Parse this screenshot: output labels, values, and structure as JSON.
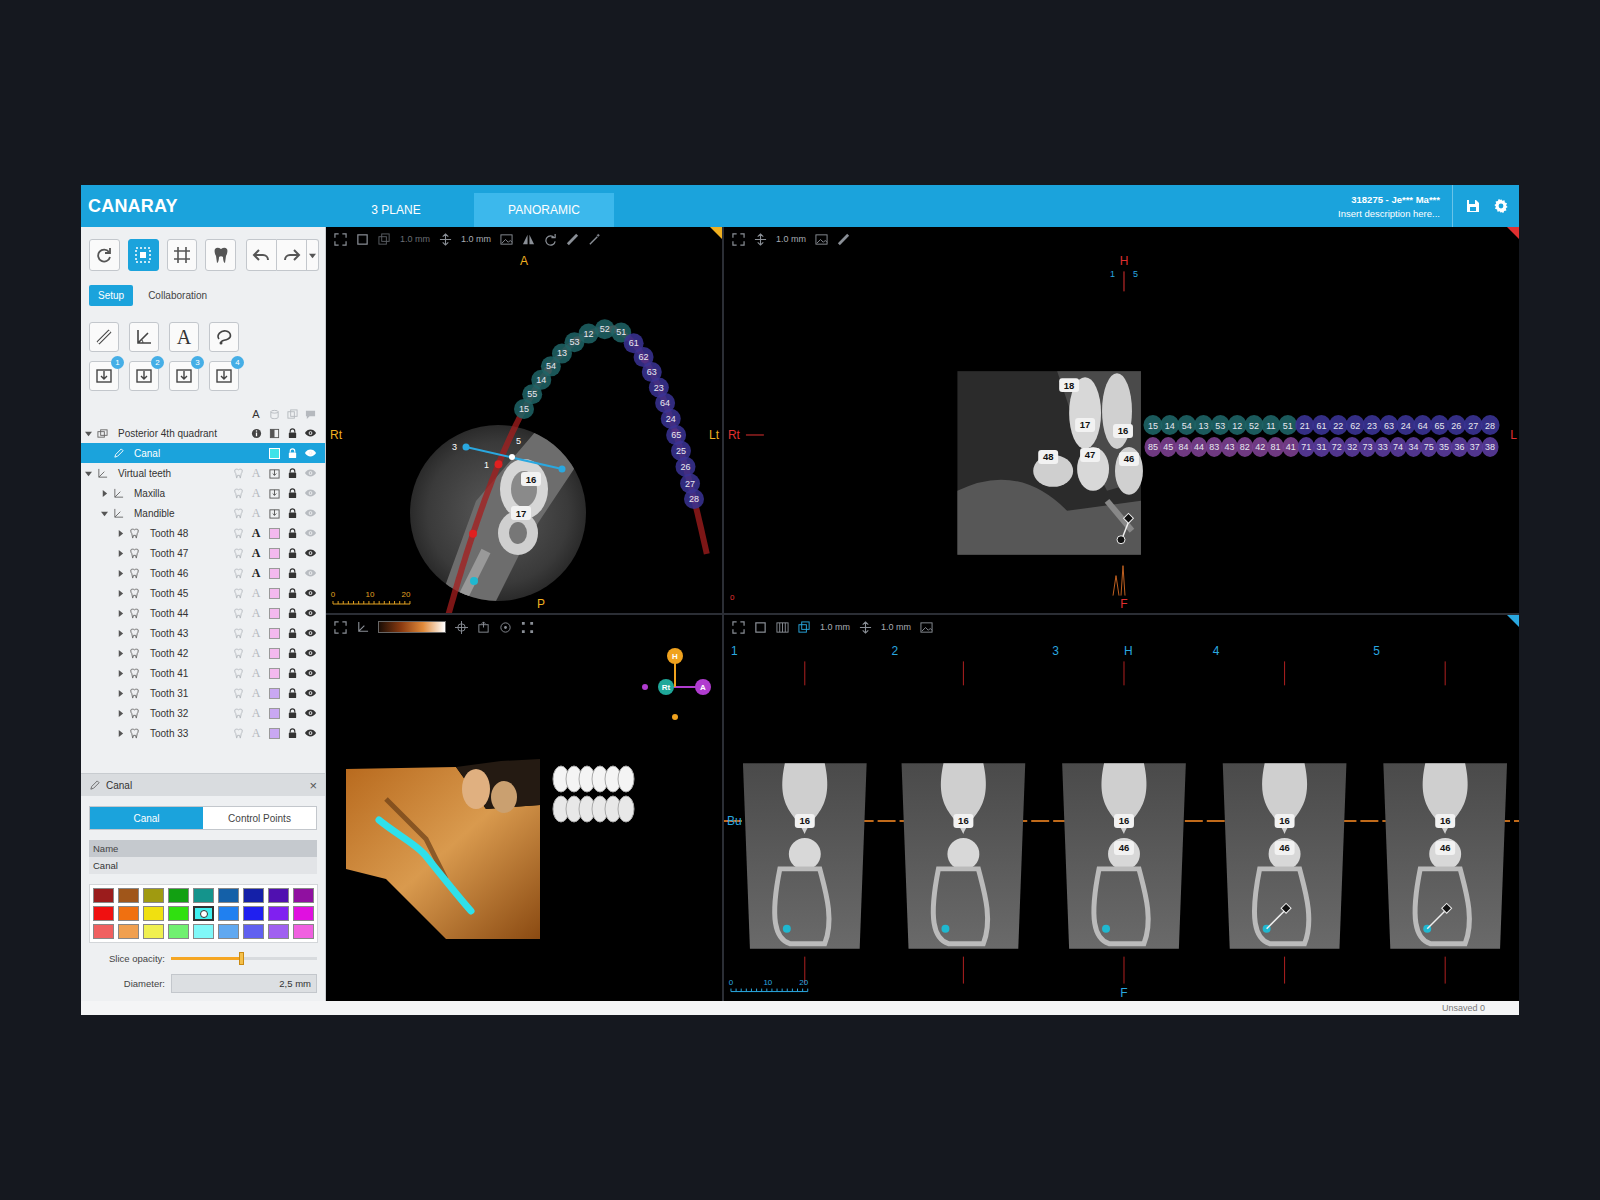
{
  "app": {
    "logo": "CANARAY",
    "tabs": [
      {
        "label": "3 PLANE",
        "selected": false
      },
      {
        "label": "PANORAMIC",
        "selected": true
      }
    ],
    "patient": {
      "id": "318275 - Je*** Ma***",
      "description": "Insert description here..."
    }
  },
  "sidebar": {
    "toolbar": [
      {
        "selected": false
      },
      {
        "selected": true
      },
      {
        "selected": false
      },
      {
        "selected": false
      },
      {
        "selected": false
      },
      {
        "selected": false
      }
    ],
    "tabs": [
      {
        "label": "Setup",
        "selected": true
      },
      {
        "label": "Collaboration",
        "selected": false
      }
    ],
    "text_tool": "A",
    "import_badges": [
      "1",
      "2",
      "3",
      "4"
    ],
    "tree": [
      {
        "label": "Posterior 4th quadrant",
        "kind": "region",
        "depth": 0,
        "expanded": true,
        "selected": false,
        "visible": true
      },
      {
        "label": "Canal",
        "kind": "canal",
        "depth": 1,
        "selected": true,
        "visible": true,
        "color": "#3fe3e8"
      },
      {
        "label": "Virtual teeth",
        "kind": "teeth",
        "depth": 0,
        "expanded": true,
        "selected": false,
        "visible": false
      },
      {
        "label": "Maxilla",
        "kind": "teeth",
        "depth": 1,
        "expanded": false,
        "selected": false,
        "visible": false
      },
      {
        "label": "Mandible",
        "kind": "teeth",
        "depth": 1,
        "expanded": true,
        "selected": false,
        "visible": false
      },
      {
        "label": "Tooth 48",
        "kind": "tooth",
        "depth": 2,
        "expanded": false,
        "selected": false,
        "visible": false,
        "labeled": true,
        "color": "#f3b9ee"
      },
      {
        "label": "Tooth 47",
        "kind": "tooth",
        "depth": 2,
        "expanded": false,
        "selected": false,
        "visible": true,
        "labeled": true,
        "color": "#f3b9ee"
      },
      {
        "label": "Tooth 46",
        "kind": "tooth",
        "depth": 2,
        "expanded": false,
        "selected": false,
        "visible": false,
        "labeled": true,
        "color": "#f3b9ee"
      },
      {
        "label": "Tooth 45",
        "kind": "tooth",
        "depth": 2,
        "expanded": false,
        "selected": false,
        "visible": true,
        "labeled": false,
        "color": "#f3b9ee"
      },
      {
        "label": "Tooth 44",
        "kind": "tooth",
        "depth": 2,
        "expanded": false,
        "selected": false,
        "visible": true,
        "labeled": false,
        "color": "#f3b9ee"
      },
      {
        "label": "Tooth 43",
        "kind": "tooth",
        "depth": 2,
        "expanded": false,
        "selected": false,
        "visible": true,
        "labeled": false,
        "color": "#f3b9ee"
      },
      {
        "label": "Tooth 42",
        "kind": "tooth",
        "depth": 2,
        "expanded": false,
        "selected": false,
        "visible": true,
        "labeled": false,
        "color": "#f3b9ee"
      },
      {
        "label": "Tooth 41",
        "kind": "tooth",
        "depth": 2,
        "expanded": false,
        "selected": false,
        "visible": true,
        "labeled": false,
        "color": "#f3b9ee"
      },
      {
        "label": "Tooth 31",
        "kind": "tooth",
        "depth": 2,
        "expanded": false,
        "selected": false,
        "visible": true,
        "labeled": false,
        "color": "#c9a8f2"
      },
      {
        "label": "Tooth 32",
        "kind": "tooth",
        "depth": 2,
        "expanded": false,
        "selected": false,
        "visible": true,
        "labeled": false,
        "color": "#c9a8f2"
      },
      {
        "label": "Tooth 33",
        "kind": "tooth",
        "depth": 2,
        "expanded": false,
        "selected": false,
        "visible": true,
        "labeled": false,
        "color": "#c9a8f2"
      }
    ],
    "canal_panel": {
      "title": "Canal",
      "close": "×",
      "tabs": [
        {
          "label": "Canal",
          "selected": true
        },
        {
          "label": "Control Points",
          "selected": false
        }
      ],
      "name_label": "Name",
      "name_value": "Canal",
      "palette": [
        {
          "color": "#9b1c1c",
          "selected": false
        },
        {
          "color": "#a0561a",
          "selected": false
        },
        {
          "color": "#a09a10",
          "selected": false
        },
        {
          "color": "#12a012",
          "selected": false
        },
        {
          "color": "#14948c",
          "selected": false
        },
        {
          "color": "#1460a8",
          "selected": false
        },
        {
          "color": "#1420a8",
          "selected": false
        },
        {
          "color": "#5010b0",
          "selected": false
        },
        {
          "color": "#9010a0",
          "selected": false
        },
        {
          "color": "#f01010",
          "selected": false
        },
        {
          "color": "#f07010",
          "selected": false
        },
        {
          "color": "#f0e010",
          "selected": false
        },
        {
          "color": "#30e010",
          "selected": false
        },
        {
          "color": "#40f0f0",
          "selected": true
        },
        {
          "color": "#2080f0",
          "selected": false
        },
        {
          "color": "#2020f0",
          "selected": false
        },
        {
          "color": "#8020f0",
          "selected": false
        },
        {
          "color": "#e010e0",
          "selected": false
        },
        {
          "color": "#f06060",
          "selected": false
        },
        {
          "color": "#f0a050",
          "selected": false
        },
        {
          "color": "#f0f050",
          "selected": false
        },
        {
          "color": "#70f070",
          "selected": false
        },
        {
          "color": "#80f8f8",
          "selected": false
        },
        {
          "color": "#60a8f0",
          "selected": false
        },
        {
          "color": "#6060f0",
          "selected": false
        },
        {
          "color": "#a060f0",
          "selected": false
        },
        {
          "color": "#f060e0",
          "selected": false
        }
      ],
      "opacity_label": "Slice opacity:",
      "opacity_level": 0.48,
      "diameter_label": "Diameter:",
      "diameter_value": "2,5 mm"
    }
  },
  "views": {
    "axial": {
      "slice": "1.0 mm",
      "thickness": "1.0 mm",
      "top": "A",
      "bottom": "P",
      "left": "Rt",
      "right": "Lt",
      "scale": [
        "0",
        "10",
        "20"
      ],
      "arch": [
        {
          "label": "15",
          "color": "#1e6466"
        },
        {
          "label": "55",
          "color": "#1e6466"
        },
        {
          "label": "14",
          "color": "#1e6466"
        },
        {
          "label": "54",
          "color": "#1e6466"
        },
        {
          "label": "13",
          "color": "#1e6466"
        },
        {
          "label": "53",
          "color": "#1e6466"
        },
        {
          "label": "12",
          "color": "#1e6466"
        },
        {
          "label": "52",
          "color": "#1e6466"
        },
        {
          "label": "51",
          "color": "#1e6466"
        },
        {
          "label": "61",
          "color": "#3a3394"
        },
        {
          "label": "62",
          "color": "#3a3394"
        },
        {
          "label": "63",
          "color": "#3a3394"
        },
        {
          "label": "23",
          "color": "#3a3394"
        },
        {
          "label": "64",
          "color": "#3a3394"
        },
        {
          "label": "24",
          "color": "#3a3394"
        },
        {
          "label": "65",
          "color": "#3a3394"
        },
        {
          "label": "25",
          "color": "#3a3394"
        },
        {
          "label": "26",
          "color": "#3a3394"
        },
        {
          "label": "27",
          "color": "#3a3394"
        },
        {
          "label": "28",
          "color": "#3a3394"
        }
      ],
      "zoom_labels": [
        "16",
        "17"
      ],
      "points": [
        "3",
        "5",
        "1"
      ]
    },
    "panoramic": {
      "thickness": "1.0 mm",
      "top": "H",
      "top_marks": [
        "1",
        "5"
      ],
      "left": "Rt",
      "right": "L",
      "bottom": "F",
      "zero": "0",
      "image_labels": [
        "18",
        "17",
        "16",
        "48",
        "47",
        "46"
      ],
      "upper": [
        {
          "label": "15",
          "color": "#1e6466"
        },
        {
          "label": "14",
          "color": "#1e6466"
        },
        {
          "label": "54",
          "color": "#1e6466"
        },
        {
          "label": "13",
          "color": "#1e6466"
        },
        {
          "label": "53",
          "color": "#1e6466"
        },
        {
          "label": "12",
          "color": "#1e6466"
        },
        {
          "label": "52",
          "color": "#1e6466"
        },
        {
          "label": "11",
          "color": "#1e6466"
        },
        {
          "label": "51",
          "color": "#1e6466"
        },
        {
          "label": "21",
          "color": "#3a3394"
        },
        {
          "label": "61",
          "color": "#3a3394"
        },
        {
          "label": "22",
          "color": "#3a3394"
        },
        {
          "label": "62",
          "color": "#3a3394"
        },
        {
          "label": "23",
          "color": "#3a3394"
        },
        {
          "label": "63",
          "color": "#3a3394"
        },
        {
          "label": "24",
          "color": "#3a3394"
        },
        {
          "label": "64",
          "color": "#3a3394"
        },
        {
          "label": "65",
          "color": "#3a3394"
        },
        {
          "label": "26",
          "color": "#3a3394"
        },
        {
          "label": "27",
          "color": "#3a3394"
        },
        {
          "label": "28",
          "color": "#3a3394"
        }
      ],
      "lower": [
        {
          "label": "85",
          "color": "#7b3f8f"
        },
        {
          "label": "45",
          "color": "#7b3f8f"
        },
        {
          "label": "84",
          "color": "#7b3f8f"
        },
        {
          "label": "44",
          "color": "#7b3f8f"
        },
        {
          "label": "83",
          "color": "#7b3f8f"
        },
        {
          "label": "43",
          "color": "#7b3f8f"
        },
        {
          "label": "82",
          "color": "#7b3f8f"
        },
        {
          "label": "42",
          "color": "#7b3f8f"
        },
        {
          "label": "81",
          "color": "#7b3f8f"
        },
        {
          "label": "41",
          "color": "#7b3f8f"
        },
        {
          "label": "71",
          "color": "#5a3b9c"
        },
        {
          "label": "31",
          "color": "#5a3b9c"
        },
        {
          "label": "72",
          "color": "#5a3b9c"
        },
        {
          "label": "32",
          "color": "#5a3b9c"
        },
        {
          "label": "73",
          "color": "#5a3b9c"
        },
        {
          "label": "33",
          "color": "#5a3b9c"
        },
        {
          "label": "74",
          "color": "#5a3b9c"
        },
        {
          "label": "34",
          "color": "#5a3b9c"
        },
        {
          "label": "75",
          "color": "#5a3b9c"
        },
        {
          "label": "35",
          "color": "#5a3b9c"
        },
        {
          "label": "36",
          "color": "#5a3b9c"
        },
        {
          "label": "37",
          "color": "#5a3b9c"
        },
        {
          "label": "38",
          "color": "#5a3b9c"
        }
      ]
    },
    "volume": {
      "axes": [
        {
          "label": "H",
          "color": "#f0a21e"
        },
        {
          "label": "Rt",
          "color": "#1fa89a"
        },
        {
          "label": "A",
          "color": "#b03ccf"
        }
      ]
    },
    "cross": {
      "slice": "1.0 mm",
      "thickness": "1.0 mm",
      "ruler": [
        "1",
        "2",
        "3",
        "H",
        "4",
        "5"
      ],
      "left": "Bu",
      "bottom": "F",
      "scale": [
        "0",
        "10",
        "20"
      ],
      "slices": [
        {
          "labels": [
            "16"
          ],
          "control_point": false
        },
        {
          "labels": [
            "16"
          ],
          "control_point": false
        },
        {
          "labels": [
            "16",
            "46"
          ],
          "control_point": false
        },
        {
          "labels": [
            "16",
            "46"
          ],
          "control_point": true
        },
        {
          "labels": [
            "16",
            "46"
          ],
          "control_point": true
        }
      ]
    }
  },
  "status": "Unsaved 0"
}
